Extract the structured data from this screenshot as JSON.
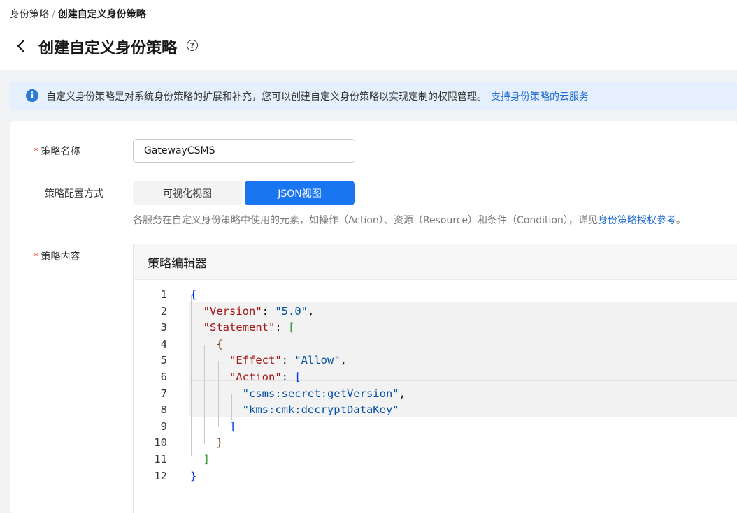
{
  "breadcrumb": {
    "parent": "身份策略",
    "separator": "/",
    "current": "创建自定义身份策略"
  },
  "page": {
    "title": "创建自定义身份策略",
    "help_glyph": "?"
  },
  "banner": {
    "text": "自定义身份策略是对系统身份策略的扩展和补充，您可以创建自定义身份策略以实现定制的权限管理。",
    "link": "支持身份策略的云服务",
    "icon_glyph": "i"
  },
  "form": {
    "required_mark": "*",
    "name_label": "策略名称",
    "name_value": "GatewayCSMS",
    "mode_label": "策略配置方式",
    "mode_options": [
      "可视化视图",
      "JSON视图"
    ],
    "mode_selected": "JSON视图",
    "hint_text": "各服务在自定义身份策略中使用的元素，如操作（Action）、资源（Resource）和条件（Condition），详见",
    "hint_link": "身份策略授权参考",
    "hint_end": "。",
    "content_label": "策略内容"
  },
  "editor": {
    "title": "策略编辑器",
    "line_numbers": [
      "1",
      "2",
      "3",
      "4",
      "5",
      "6",
      "7",
      "8",
      "9",
      "10",
      "11",
      "12"
    ],
    "lines": [
      [
        {
          "t": "{",
          "c": "b1"
        }
      ],
      [
        {
          "t": "  "
        },
        {
          "t": "\"Version\"",
          "c": "k"
        },
        {
          "t": ": ",
          "c": "p"
        },
        {
          "t": "\"5.0\"",
          "c": "s"
        },
        {
          "t": ",",
          "c": "p"
        }
      ],
      [
        {
          "t": "  "
        },
        {
          "t": "\"Statement\"",
          "c": "k"
        },
        {
          "t": ": ",
          "c": "p"
        },
        {
          "t": "[",
          "c": "b2"
        }
      ],
      [
        {
          "t": "    "
        },
        {
          "t": "{",
          "c": "b3"
        }
      ],
      [
        {
          "t": "      "
        },
        {
          "t": "\"Effect\"",
          "c": "k"
        },
        {
          "t": ": ",
          "c": "p"
        },
        {
          "t": "\"Allow\"",
          "c": "s"
        },
        {
          "t": ",",
          "c": "p"
        }
      ],
      [
        {
          "t": "      "
        },
        {
          "t": "\"Action\"",
          "c": "k"
        },
        {
          "t": ": ",
          "c": "p"
        },
        {
          "t": "[",
          "c": "b1"
        }
      ],
      [
        {
          "t": "        "
        },
        {
          "t": "\"csms:secret:getVersion\"",
          "c": "s"
        },
        {
          "t": ",",
          "c": "p"
        }
      ],
      [
        {
          "t": "        "
        },
        {
          "t": "\"kms:cmk:decryptDataKey\"",
          "c": "s"
        }
      ],
      [
        {
          "t": "      "
        },
        {
          "t": "]",
          "c": "b1"
        }
      ],
      [
        {
          "t": "    "
        },
        {
          "t": "}",
          "c": "b3"
        }
      ],
      [
        {
          "t": "  "
        },
        {
          "t": "]",
          "c": "b2"
        }
      ],
      [
        {
          "t": "}",
          "c": "b1"
        }
      ]
    ]
  }
}
